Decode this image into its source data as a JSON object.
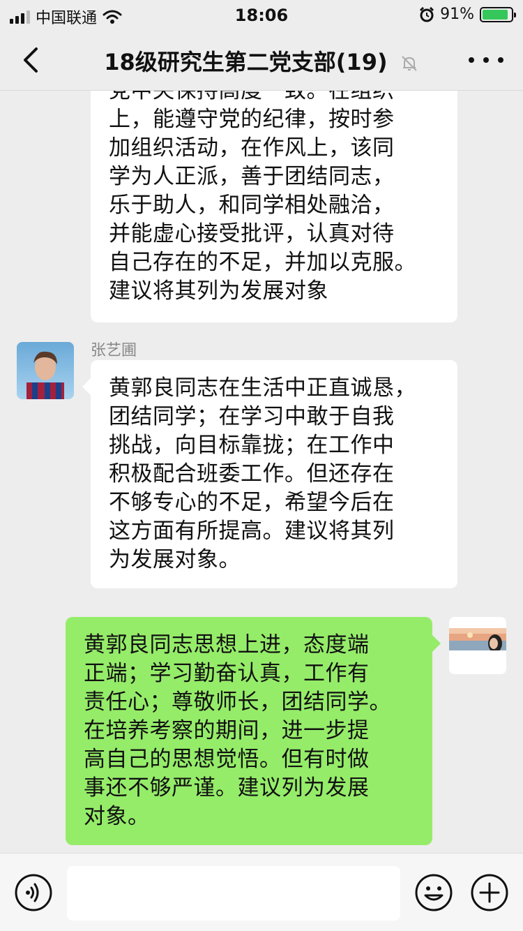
{
  "status_bar": {
    "carrier": "中国联通",
    "time": "18:06",
    "battery": "91%",
    "battery_level": 0.91
  },
  "nav": {
    "title": "18级研究生第二党支部(19)",
    "back_icon": "chevron-left-icon",
    "mute_icon": "bell-muted-icon",
    "more_icon": "ellipsis-icon"
  },
  "messages": [
    {
      "side": "left",
      "sender": "",
      "lines": [
        "党中央保持高度一致。在组织",
        "上，能遵守党的纪律，按时参",
        "加组织活动，在作风上，该同",
        "学为人正派，善于团结同志，",
        "乐于助人，和同学相处融洽，",
        "并能虚心接受批评，认真对待",
        "自己存在的不足，并加以克服。",
        "建议将其列为发展对象"
      ]
    },
    {
      "side": "left",
      "sender": "张艺圃",
      "lines": [
        "黄郭良同志在生活中正直诚恳，",
        "团结同学；在学习中敢于自我",
        "挑战，向目标靠拢；在工作中",
        "积极配合班委工作。但还存在",
        "不够专心的不足，希望今后在",
        "这方面有所提高。建议将其列",
        "为发展对象。"
      ]
    },
    {
      "side": "right",
      "sender": "",
      "lines": [
        "黄郭良同志思想上进，态度端",
        "正端；学习勤奋认真，工作有",
        "责任心；尊敬师长，团结同学。",
        "在培养考察的期间，进一步提",
        "高自己的思想觉悟。但有时做",
        "事还不够严谨。建议列为发展",
        "对象。"
      ]
    }
  ],
  "input_bar": {
    "voice_icon": "voice-icon",
    "emoji_icon": "emoji-icon",
    "add_icon": "plus-circle-icon",
    "placeholder": ""
  },
  "colors": {
    "background": "#ededed",
    "bubble_left": "#ffffff",
    "bubble_right": "#95ec69"
  }
}
